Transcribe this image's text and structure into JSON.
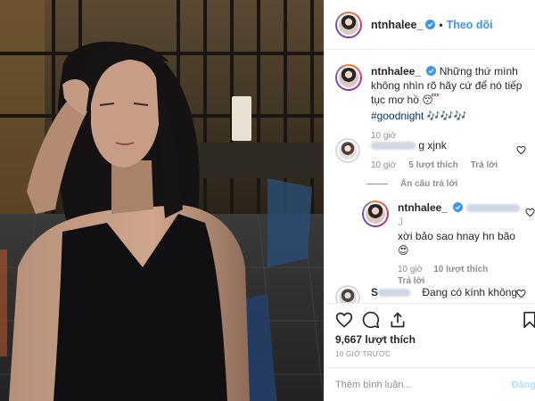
{
  "header": {
    "username": "ntnhalee_",
    "dot": "•",
    "follow_label": "Theo dõi"
  },
  "caption": {
    "username": "ntnhalee_",
    "text": "Những thứ mình không nhìn rõ hãy cứ để nó tiếp tục mơ hồ 😴",
    "hashtag": "#goodnight",
    "emoji_after_hashtag": "🎶🎶🎶",
    "time": "10 giờ"
  },
  "comments": [
    {
      "username_hidden": true,
      "text": "g xjnk",
      "time": "10 giờ",
      "likes": "5 lượt thích",
      "reply_label": "Trả lời",
      "hide_replies_label": "Ẩn câu trả lời",
      "reply": {
        "username": "ntnhalee_",
        "mention_hidden": true,
        "mention_tail": "J",
        "text": "xời bảo sao hnay hn bão",
        "emoji": "😍",
        "time": "10 giờ",
        "likes": "10 lượt thích",
        "reply_label": "Trả lời"
      }
    },
    {
      "username_hidden": true,
      "username_partial": "S",
      "text": "Đang có kính không"
    }
  ],
  "actions": {
    "likes_count": "9,667 lượt thích",
    "time_ago": "10 GIỜ TRƯỚC",
    "icons": [
      "heart-icon",
      "comment-icon",
      "share-icon",
      "bookmark-icon"
    ]
  },
  "add_comment": {
    "placeholder": "Thêm bình luận...",
    "post_label": "Đăng"
  },
  "colors": {
    "link_blue": "#3897f0",
    "hashtag": "#003569",
    "muted": "#8e8e8e",
    "post_disabled": "#b2dffc"
  }
}
